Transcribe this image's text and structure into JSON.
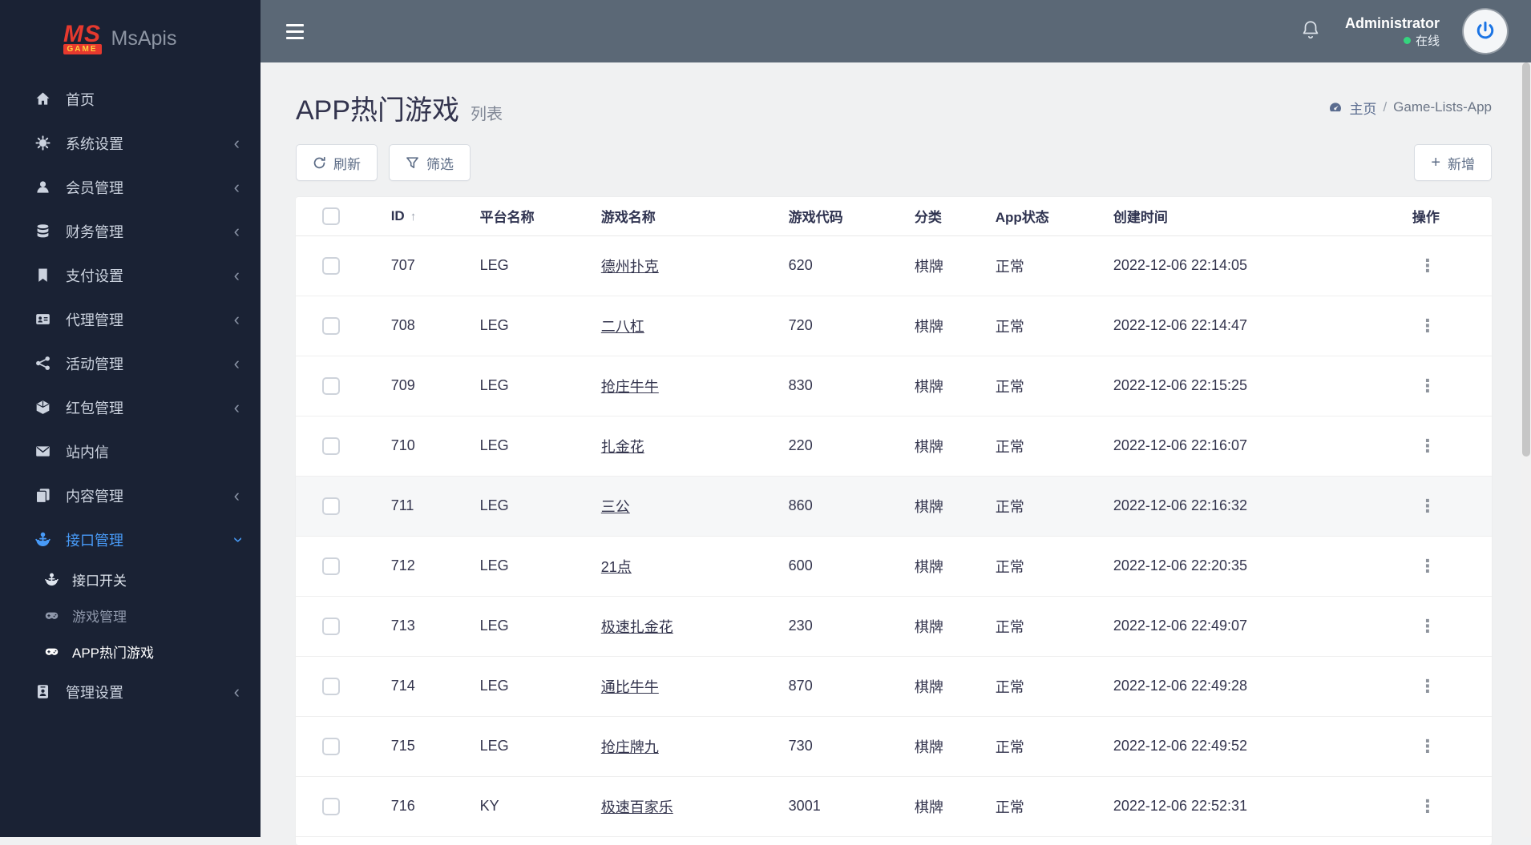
{
  "app": {
    "logo_ms": "MS",
    "logo_game": "GAME",
    "logo_name": "MsApis"
  },
  "header": {
    "user_name": "Administrator",
    "user_status": "在线"
  },
  "sidebar": {
    "items": [
      {
        "key": "home",
        "label": "首页",
        "icon": "home",
        "chevron": false
      },
      {
        "key": "system-settings",
        "label": "系统设置",
        "icon": "gears",
        "chevron": "left"
      },
      {
        "key": "member-management",
        "label": "会员管理",
        "icon": "user",
        "chevron": "left"
      },
      {
        "key": "finance-management",
        "label": "财务管理",
        "icon": "database",
        "chevron": "left"
      },
      {
        "key": "payment-settings",
        "label": "支付设置",
        "icon": "bookmark",
        "chevron": "left"
      },
      {
        "key": "agent-management",
        "label": "代理管理",
        "icon": "id-card",
        "chevron": "left"
      },
      {
        "key": "activity-management",
        "label": "活动管理",
        "icon": "share",
        "chevron": "left"
      },
      {
        "key": "redpacket-management",
        "label": "红包管理",
        "icon": "cube",
        "chevron": "left"
      },
      {
        "key": "site-mail",
        "label": "站内信",
        "icon": "envelope",
        "chevron": false
      },
      {
        "key": "content-management",
        "label": "内容管理",
        "icon": "copy",
        "chevron": "left"
      },
      {
        "key": "api-management",
        "label": "接口管理",
        "icon": "anchor",
        "chevron": "down",
        "active": true,
        "children": [
          {
            "key": "api-switch",
            "label": "接口开关",
            "icon": "anchor",
            "bright": true
          },
          {
            "key": "game-management",
            "label": "游戏管理",
            "icon": "gamepad"
          },
          {
            "key": "app-hot-games",
            "label": "APP热门游戏",
            "icon": "gamepad",
            "active": true
          }
        ]
      },
      {
        "key": "admin-settings",
        "label": "管理设置",
        "icon": "id-badge",
        "chevron": "left"
      }
    ]
  },
  "page": {
    "title": "APP热门游戏",
    "subtitle": "列表",
    "breadcrumb_home": "主页",
    "breadcrumb_sep": "/",
    "breadcrumb_current": "Game-Lists-App"
  },
  "toolbar": {
    "refresh_label": "刷新",
    "filter_label": "筛选",
    "add_label": "新增"
  },
  "icons": {
    "kebab_menu": "⋮",
    "sort_ascending": "↑",
    "plus": "+",
    "chevron_collapsed": "‹"
  },
  "table": {
    "columns": [
      "ID",
      "平台名称",
      "游戏名称",
      "游戏代码",
      "分类",
      "App状态",
      "创建时间",
      "操作"
    ],
    "column_classes": [
      "c-id",
      "c-platform",
      "c-name",
      "c-code",
      "c-cat",
      "c-status",
      "c-created",
      "c-action"
    ],
    "sort_column": "ID",
    "hover_row_id": "711",
    "rows": [
      {
        "id": "707",
        "platform": "LEG",
        "name": "德州扑克",
        "code": "620",
        "category": "棋牌",
        "status": "正常",
        "created": "2022-12-06 22:14:05"
      },
      {
        "id": "708",
        "platform": "LEG",
        "name": "二八杠",
        "code": "720",
        "category": "棋牌",
        "status": "正常",
        "created": "2022-12-06 22:14:47"
      },
      {
        "id": "709",
        "platform": "LEG",
        "name": "抢庄牛牛",
        "code": "830",
        "category": "棋牌",
        "status": "正常",
        "created": "2022-12-06 22:15:25"
      },
      {
        "id": "710",
        "platform": "LEG",
        "name": "扎金花",
        "code": "220",
        "category": "棋牌",
        "status": "正常",
        "created": "2022-12-06 22:16:07"
      },
      {
        "id": "711",
        "platform": "LEG",
        "name": "三公",
        "code": "860",
        "category": "棋牌",
        "status": "正常",
        "created": "2022-12-06 22:16:32"
      },
      {
        "id": "712",
        "platform": "LEG",
        "name": "21点",
        "code": "600",
        "category": "棋牌",
        "status": "正常",
        "created": "2022-12-06 22:20:35"
      },
      {
        "id": "713",
        "platform": "LEG",
        "name": "极速扎金花",
        "code": "230",
        "category": "棋牌",
        "status": "正常",
        "created": "2022-12-06 22:49:07"
      },
      {
        "id": "714",
        "platform": "LEG",
        "name": "通比牛牛",
        "code": "870",
        "category": "棋牌",
        "status": "正常",
        "created": "2022-12-06 22:49:28"
      },
      {
        "id": "715",
        "platform": "LEG",
        "name": "抢庄牌九",
        "code": "730",
        "category": "棋牌",
        "status": "正常",
        "created": "2022-12-06 22:49:52"
      },
      {
        "id": "716",
        "platform": "KY",
        "name": "极速百家乐",
        "code": "3001",
        "category": "棋牌",
        "status": "正常",
        "created": "2022-12-06 22:52:31"
      }
    ]
  },
  "colors": {
    "sidebar_bg": "#1a2234",
    "header_bg": "#5b6876",
    "accent_blue": "#489bf8",
    "online_green": "#35d47e",
    "logo_red": "#e6392e",
    "logo_yellow": "#ffd23f"
  }
}
